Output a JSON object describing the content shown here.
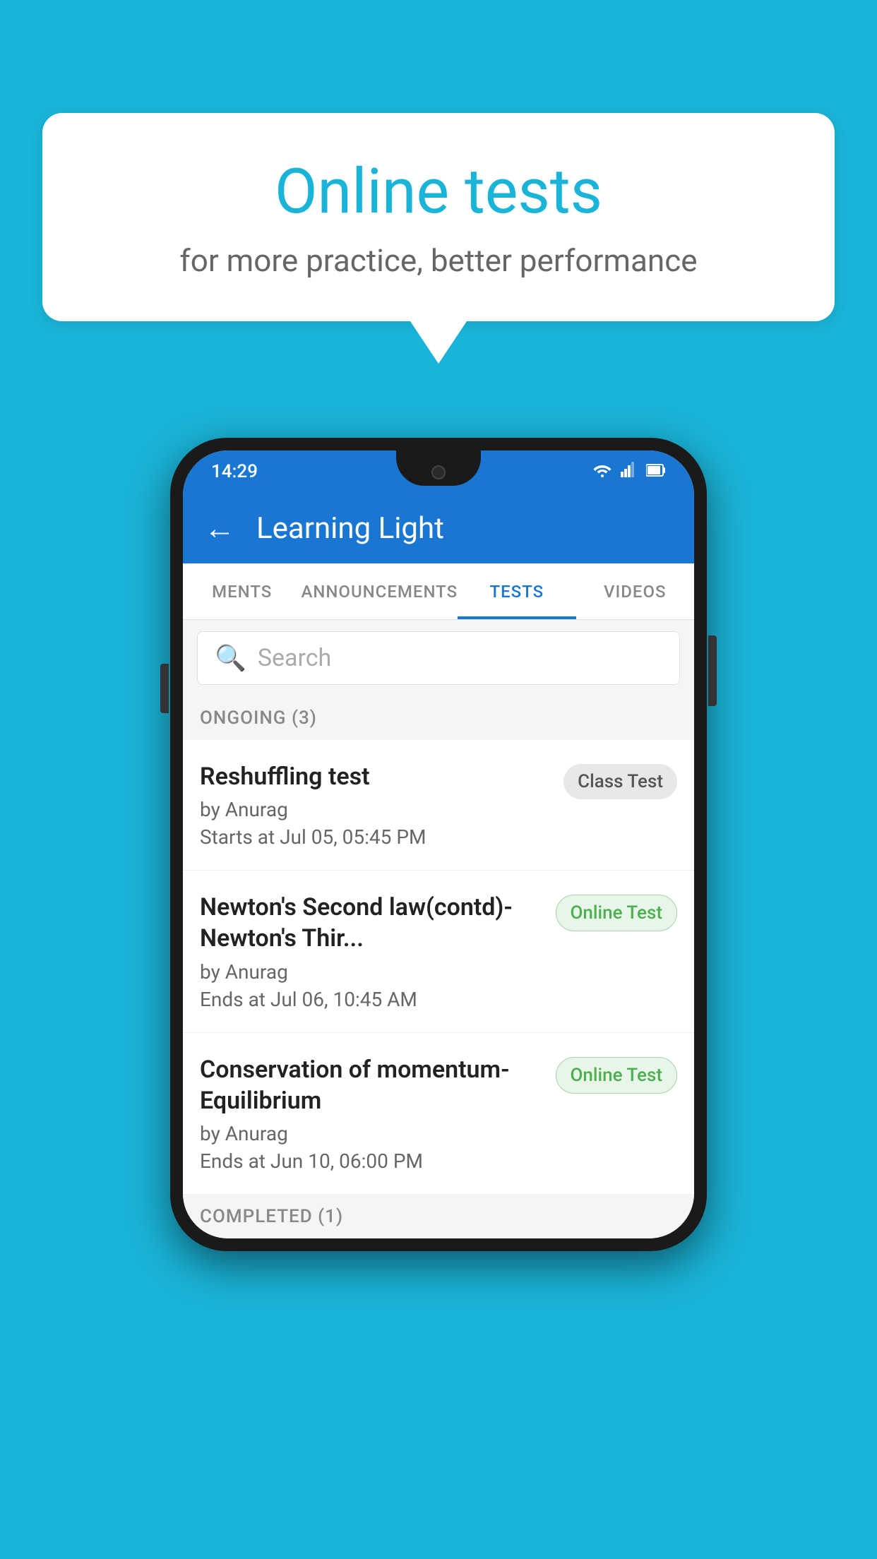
{
  "background": {
    "color": "#1ab4d8"
  },
  "speech_bubble": {
    "title": "Online tests",
    "subtitle": "for more practice, better performance"
  },
  "phone": {
    "status_bar": {
      "time": "14:29",
      "icons": [
        "wifi",
        "signal",
        "battery"
      ]
    },
    "app_bar": {
      "title": "Learning Light",
      "back_label": "←"
    },
    "tabs": [
      {
        "label": "MENTS",
        "active": false
      },
      {
        "label": "ANNOUNCEMENTS",
        "active": false
      },
      {
        "label": "TESTS",
        "active": true
      },
      {
        "label": "VIDEOS",
        "active": false
      }
    ],
    "search": {
      "placeholder": "Search"
    },
    "ongoing_section": {
      "label": "ONGOING (3)"
    },
    "test_items": [
      {
        "title": "Reshuffling test",
        "author": "by Anurag",
        "time_label": "Starts at",
        "time": "Jul 05, 05:45 PM",
        "badge": "Class Test",
        "badge_type": "class"
      },
      {
        "title": "Newton's Second law(contd)-Newton's Thir...",
        "author": "by Anurag",
        "time_label": "Ends at",
        "time": "Jul 06, 10:45 AM",
        "badge": "Online Test",
        "badge_type": "online"
      },
      {
        "title": "Conservation of momentum-Equilibrium",
        "author": "by Anurag",
        "time_label": "Ends at",
        "time": "Jun 10, 06:00 PM",
        "badge": "Online Test",
        "badge_type": "online"
      }
    ],
    "completed_section": {
      "label": "COMPLETED (1)"
    }
  }
}
